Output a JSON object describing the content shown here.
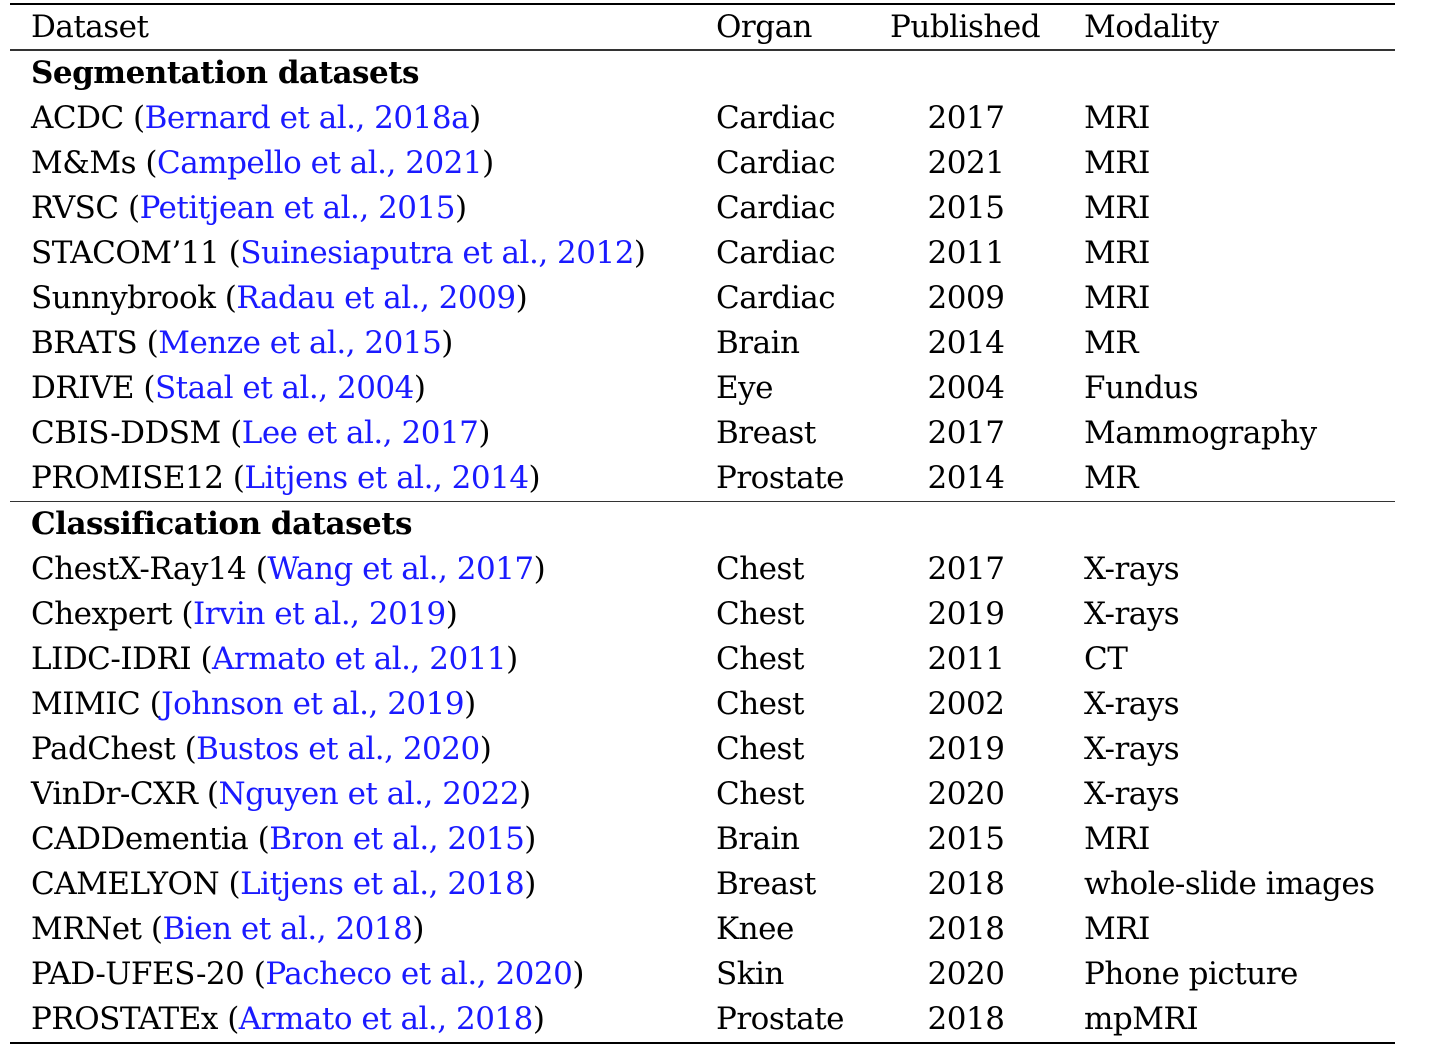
{
  "table": {
    "columns": [
      "Dataset",
      "Organ",
      "Published",
      "Modality"
    ],
    "link_color": "#1a1aff",
    "sections": [
      {
        "title": "Segmentation datasets",
        "rows": [
          {
            "dataset": "ACDC",
            "citation": "Bernard et al., 2018a",
            "organ": "Cardiac",
            "published": "2017",
            "modality": "MRI"
          },
          {
            "dataset": "M&Ms",
            "citation": "Campello et al., 2021",
            "organ": "Cardiac",
            "published": "2021",
            "modality": "MRI"
          },
          {
            "dataset": "RVSC",
            "citation": "Petitjean et al., 2015",
            "organ": "Cardiac",
            "published": "2015",
            "modality": "MRI"
          },
          {
            "dataset": "STACOM’11",
            "citation": "Suinesiaputra et al., 2012",
            "organ": "Cardiac",
            "published": "2011",
            "modality": "MRI"
          },
          {
            "dataset": "Sunnybrook",
            "citation": "Radau et al., 2009",
            "organ": "Cardiac",
            "published": "2009",
            "modality": "MRI"
          },
          {
            "dataset": "BRATS",
            "citation": "Menze et al., 2015",
            "organ": "Brain",
            "published": "2014",
            "modality": "MR"
          },
          {
            "dataset": "DRIVE",
            "citation": "Staal et al., 2004",
            "organ": "Eye",
            "published": "2004",
            "modality": "Fundus"
          },
          {
            "dataset": "CBIS-DDSM",
            "citation": "Lee et al., 2017",
            "organ": "Breast",
            "published": "2017",
            "modality": "Mammography"
          },
          {
            "dataset": "PROMISE12",
            "citation": "Litjens et al., 2014",
            "organ": "Prostate",
            "published": "2014",
            "modality": "MR"
          }
        ]
      },
      {
        "title": "Classification datasets",
        "rows": [
          {
            "dataset": "ChestX-Ray14",
            "citation": "Wang et al., 2017",
            "organ": "Chest",
            "published": "2017",
            "modality": "X-rays"
          },
          {
            "dataset": "Chexpert",
            "citation": "Irvin et al., 2019",
            "organ": "Chest",
            "published": "2019",
            "modality": "X-rays"
          },
          {
            "dataset": "LIDC-IDRI",
            "citation": "Armato et al., 2011",
            "organ": "Chest",
            "published": "2011",
            "modality": "CT"
          },
          {
            "dataset": "MIMIC",
            "citation": "Johnson et al., 2019",
            "organ": "Chest",
            "published": "2002",
            "modality": "X-rays"
          },
          {
            "dataset": "PadChest",
            "citation": "Bustos et al., 2020",
            "organ": "Chest",
            "published": "2019",
            "modality": "X-rays"
          },
          {
            "dataset": "VinDr-CXR",
            "citation": "Nguyen et al., 2022",
            "organ": "Chest",
            "published": "2020",
            "modality": "X-rays"
          },
          {
            "dataset": "CADDementia",
            "citation": "Bron et al., 2015",
            "organ": "Brain",
            "published": "2015",
            "modality": "MRI"
          },
          {
            "dataset": "CAMELYON",
            "citation": "Litjens et al., 2018",
            "organ": "Breast",
            "published": "2018",
            "modality": "whole-slide images"
          },
          {
            "dataset": "MRNet",
            "citation": "Bien et al., 2018",
            "organ": "Knee",
            "published": "2018",
            "modality": "MRI"
          },
          {
            "dataset": "PAD-UFES-20",
            "citation": "Pacheco et al., 2020",
            "organ": "Skin",
            "published": "2020",
            "modality": "Phone picture"
          },
          {
            "dataset": "PROSTATEx",
            "citation": "Armato et al., 2018",
            "organ": "Prostate",
            "published": "2018",
            "modality": "mpMRI"
          }
        ]
      }
    ]
  }
}
